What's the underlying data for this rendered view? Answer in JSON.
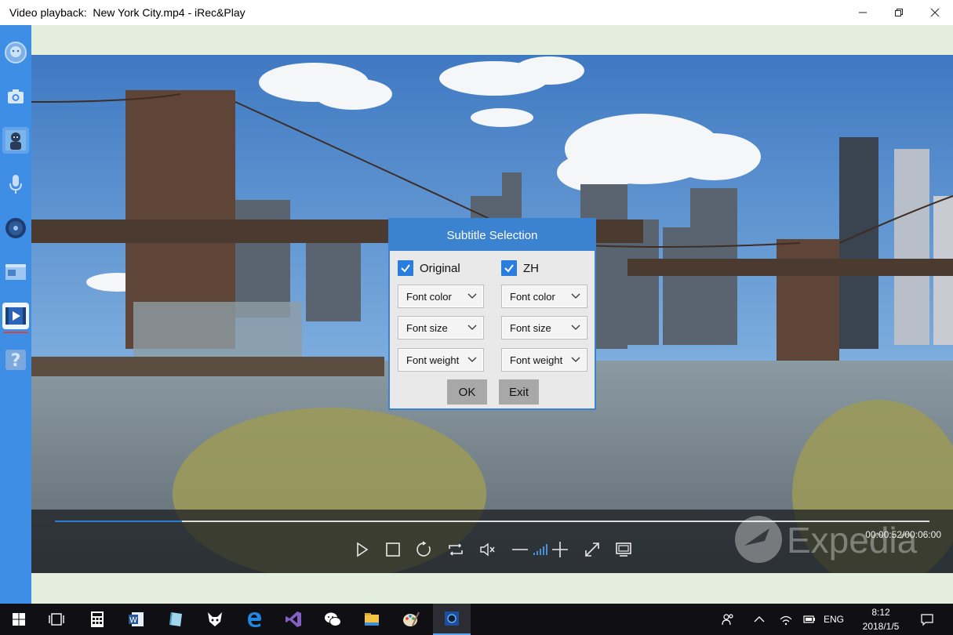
{
  "window": {
    "title": "Video playback:  New York City.mp4 - iRec&Play",
    "minimize_icon": "minimize-icon",
    "maximize_icon": "restore-icon",
    "close_icon": "close-icon"
  },
  "sidebar": {
    "items": [
      {
        "name": "home",
        "icon": "logo-face-icon"
      },
      {
        "name": "screenshot",
        "icon": "camera-icon"
      },
      {
        "name": "record-avatar",
        "icon": "avatar-icon"
      },
      {
        "name": "audio",
        "icon": "microphone-icon"
      },
      {
        "name": "disc",
        "icon": "disc-icon"
      },
      {
        "name": "screen-record",
        "icon": "screen-capture-icon"
      },
      {
        "name": "video-playback",
        "icon": "video-play-icon",
        "active": true
      },
      {
        "name": "help",
        "icon": "help-icon"
      }
    ],
    "accent": "#3f8ee5",
    "active_marker": "#d9443b"
  },
  "player": {
    "video_file": "New York City.mp4",
    "time": "00:00:52/00:06:00",
    "progress": 0.145,
    "watermark": "Expedia",
    "controls": [
      "play-icon",
      "stop-icon",
      "replay-icon",
      "loop-icon",
      "mute-icon",
      "volume-down-icon",
      "volume-level-icon",
      "volume-up-icon",
      "fullscreen-icon",
      "screen-mode-icon"
    ]
  },
  "dialog": {
    "title": "Subtitle Selection",
    "columns": [
      {
        "label": "Original",
        "checked": true,
        "font_color": "Font color",
        "font_size": "Font size",
        "font_weight": "Font weight"
      },
      {
        "label": "ZH",
        "checked": true,
        "font_color": "Font color",
        "font_size": "Font size",
        "font_weight": "Font weight"
      }
    ],
    "ok_label": "OK",
    "exit_label": "Exit",
    "accent": "#3b83d1"
  },
  "taskbar": {
    "apps": [
      "windows-start-icon",
      "task-view-icon",
      "calculator-icon",
      "word-icon",
      "notes-icon",
      "fox-app-icon",
      "edge-icon",
      "visual-studio-icon",
      "wechat-icon",
      "file-explorer-icon",
      "paint-icon",
      "irecplay-icon"
    ],
    "language": "ENG",
    "time": "8:12",
    "date": "2018/1/5"
  }
}
